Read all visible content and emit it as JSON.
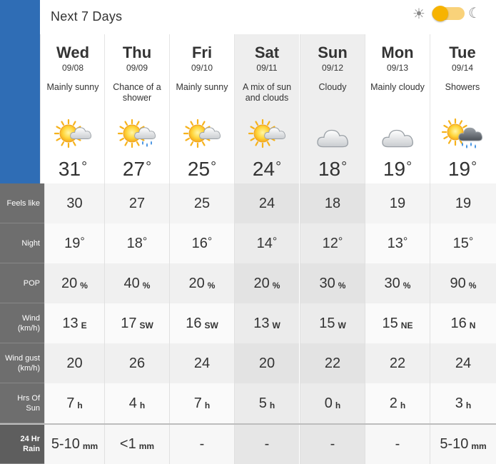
{
  "header": {
    "title": "Next 7 Days"
  },
  "theme_toggle": {
    "sun_icon": "sun-icon",
    "moon_icon": "moon-icon",
    "accent": "#f7b300"
  },
  "days": [
    {
      "name": "Wed",
      "date": "09/08",
      "condition": "Mainly sunny",
      "icon": "sun-cloud-icon",
      "temp": "31",
      "feels": "30",
      "night": "19",
      "pop": "20",
      "wind": "13",
      "wind_dir": "E",
      "gust": "20",
      "sun_hrs": "7",
      "rain": "5-10",
      "rain_unit": "mm"
    },
    {
      "name": "Thu",
      "date": "09/09",
      "condition": "Chance of a shower",
      "icon": "sun-cloud-rain-icon",
      "temp": "27",
      "feels": "27",
      "night": "18",
      "pop": "40",
      "wind": "17",
      "wind_dir": "SW",
      "gust": "26",
      "sun_hrs": "4",
      "rain": "<1",
      "rain_unit": "mm"
    },
    {
      "name": "Fri",
      "date": "09/10",
      "condition": "Mainly sunny",
      "icon": "sun-cloud-icon",
      "temp": "25",
      "feels": "25",
      "night": "16",
      "pop": "20",
      "wind": "16",
      "wind_dir": "SW",
      "gust": "24",
      "sun_hrs": "7",
      "rain": "-",
      "rain_unit": ""
    },
    {
      "name": "Sat",
      "date": "09/11",
      "condition": "A mix of sun and clouds",
      "icon": "sun-cloud-icon",
      "temp": "24",
      "feels": "24",
      "night": "14",
      "pop": "20",
      "wind": "13",
      "wind_dir": "W",
      "gust": "20",
      "sun_hrs": "5",
      "rain": "-",
      "rain_unit": ""
    },
    {
      "name": "Sun",
      "date": "09/12",
      "condition": "Cloudy",
      "icon": "cloud-icon",
      "temp": "18",
      "feels": "18",
      "night": "12",
      "pop": "30",
      "wind": "15",
      "wind_dir": "W",
      "gust": "22",
      "sun_hrs": "0",
      "rain": "-",
      "rain_unit": ""
    },
    {
      "name": "Mon",
      "date": "09/13",
      "condition": "Mainly cloudy",
      "icon": "cloud-icon",
      "temp": "19",
      "feels": "19",
      "night": "13",
      "pop": "30",
      "wind": "15",
      "wind_dir": "NE",
      "gust": "22",
      "sun_hrs": "2",
      "rain": "-",
      "rain_unit": ""
    },
    {
      "name": "Tue",
      "date": "09/14",
      "condition": "Showers",
      "icon": "sun-cloud-showers-icon",
      "temp": "19",
      "feels": "19",
      "night": "15",
      "pop": "90",
      "wind": "16",
      "wind_dir": "N",
      "gust": "24",
      "sun_hrs": "3",
      "rain": "5-10",
      "rain_unit": "mm"
    }
  ],
  "labels": {
    "feels": "Feels like",
    "night": "Night",
    "pop": "POP",
    "wind": "Wind (km/h)",
    "gust": "Wind gust (km/h)",
    "sun": "Hrs Of Sun",
    "rain": "24 Hr Rain"
  },
  "units": {
    "deg": "°",
    "pop": "%",
    "hours": "h"
  }
}
